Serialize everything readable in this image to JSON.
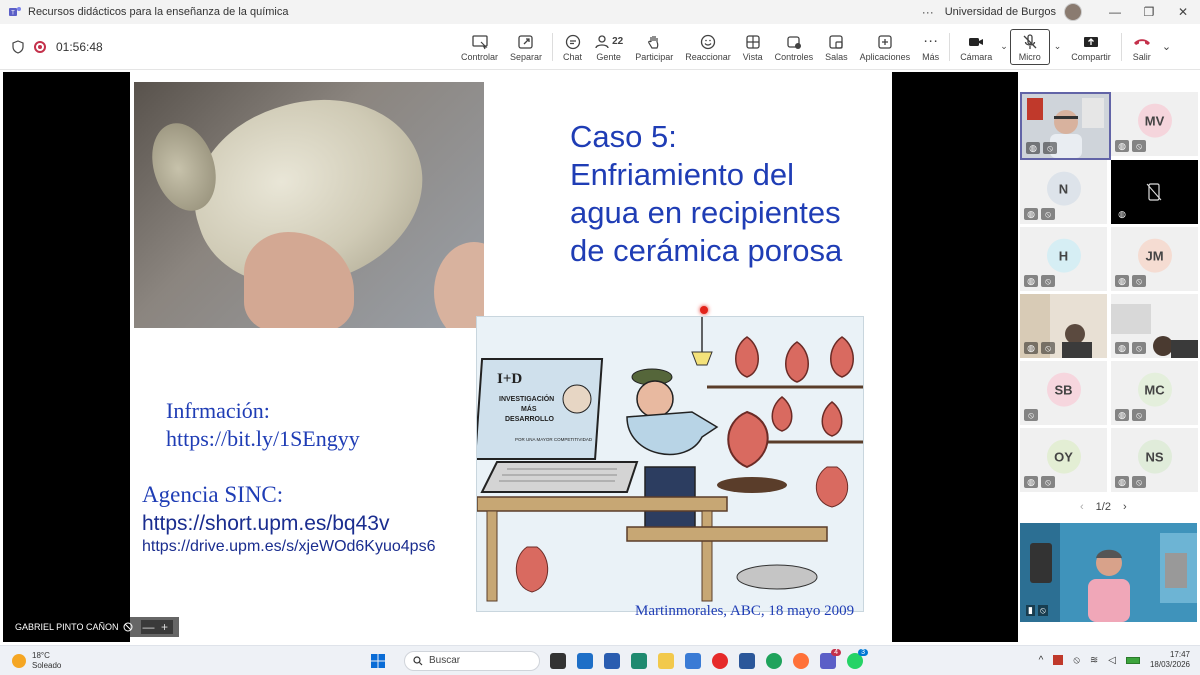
{
  "window": {
    "title": "Recursos didácticos para la enseñanza de la química",
    "organization": "Universidad de Burgos",
    "more": "···",
    "minimize": "—",
    "restore": "❐",
    "close": "✕"
  },
  "meeting": {
    "timer": "01:56:48"
  },
  "toolbar": {
    "controlar": "Controlar",
    "separar": "Separar",
    "chat": "Chat",
    "gente": "Gente",
    "gente_count": "22",
    "participar": "Participar",
    "reaccionar": "Reaccionar",
    "vista": "Vista",
    "controles": "Controles",
    "salas": "Salas",
    "aplicaciones": "Aplicaciones",
    "mas": "Más",
    "camara": "Cámara",
    "micro": "Micro",
    "compartir": "Compartir",
    "salir": "Salir"
  },
  "slide": {
    "title_lines": [
      "Caso 5:",
      "Enfriamiento del",
      "agua en recipientes",
      "de cerámica porosa"
    ],
    "info_label": "Infrmación:",
    "info_link": "https://bit.ly/1SEngyy",
    "sinc_label": "Agencia SINC:",
    "sinc_link1": "https://short.upm.es/bq43v",
    "sinc_link2": "https://drive.upm.es/s/xjeWOd6Kyuo4ps6",
    "caption": "Martinmorales, ABC, 18 mayo 2009",
    "cartoon_sign_top": "I+D",
    "cartoon_sign_lines": [
      "INVESTIGACIÓN",
      "MÁS",
      "DESARROLLO"
    ],
    "cartoon_sign_small": "POR UNA MAYOR COMPETITIVIDAD"
  },
  "speaker": {
    "name": "GABRIEL PINTO CAÑON",
    "zoom_out": "—",
    "zoom_in": "+"
  },
  "participants": [
    {
      "initials": "",
      "type": "video"
    },
    {
      "initials": "MV",
      "color": "#f5d5dc"
    },
    {
      "initials": "N",
      "color": "#dde3ea"
    },
    {
      "initials": "",
      "type": "dark"
    },
    {
      "initials": "H",
      "color": "#d6eef4"
    },
    {
      "initials": "JM",
      "color": "#f5dcd2"
    },
    {
      "initials": "",
      "type": "video"
    },
    {
      "initials": "",
      "type": "video"
    },
    {
      "initials": "SB",
      "color": "#f6d6de"
    },
    {
      "initials": "MC",
      "color": "#e4efdc"
    },
    {
      "initials": "OY",
      "color": "#e3eed4"
    },
    {
      "initials": "NS",
      "color": "#e0ecda"
    }
  ],
  "pager": {
    "label": "1/2",
    "prev": "‹",
    "next": "›"
  },
  "taskbar": {
    "temperature": "18°C",
    "weather": "Soleado",
    "search_placeholder": "Buscar",
    "teams_badge": "4",
    "whatsapp_badge": "3",
    "time": "17:47",
    "date": "18/03/2026"
  },
  "colors": {
    "slide_text": "#1f3db5",
    "accent": "#6264a7",
    "leave": "#c4314b"
  }
}
